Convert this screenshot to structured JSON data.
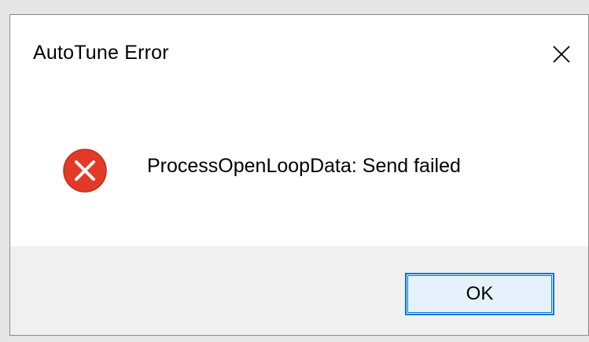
{
  "dialog": {
    "title": "AutoTune Error",
    "close_icon": "close-icon",
    "icon": "error-icon",
    "message": "ProcessOpenLoopData: Send failed",
    "ok_label": "OK"
  },
  "colors": {
    "error_red": "#e81123",
    "accent_blue": "#0078d7",
    "footer_bg": "#f0f0f0"
  }
}
